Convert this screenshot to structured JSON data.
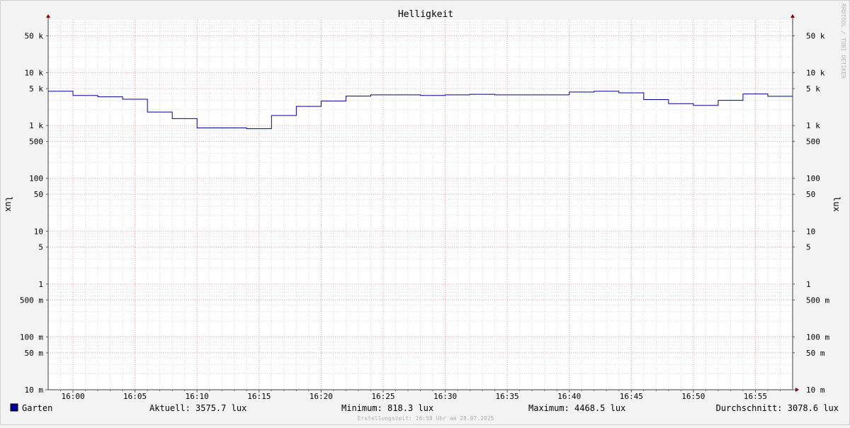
{
  "chart_data": {
    "type": "line",
    "title": "Helligkeit",
    "ylabel": "lux",
    "y_scale": "log",
    "ylim": [
      0.01,
      100000
    ],
    "y_ticks": [
      {
        "value": 50000,
        "label": "50 k",
        "major": true
      },
      {
        "value": 10000,
        "label": "10 k",
        "major": true
      },
      {
        "value": 5000,
        "label": "5 k",
        "major": true
      },
      {
        "value": 1000,
        "label": "1 k",
        "major": true
      },
      {
        "value": 500,
        "label": "500",
        "major": true
      },
      {
        "value": 100,
        "label": "100",
        "major": true
      },
      {
        "value": 50,
        "label": "50",
        "major": true
      },
      {
        "value": 10,
        "label": "10",
        "major": true
      },
      {
        "value": 5,
        "label": "5",
        "major": true
      },
      {
        "value": 1,
        "label": "1",
        "major": true
      },
      {
        "value": 0.5,
        "label": "500 m",
        "major": true
      },
      {
        "value": 0.1,
        "label": "100 m",
        "major": true
      },
      {
        "value": 0.05,
        "label": "50 m",
        "major": true
      },
      {
        "value": 0.01,
        "label": "10 m",
        "major": true
      }
    ],
    "x_range": [
      "15:58",
      "16:58"
    ],
    "x_ticks": [
      "16:00",
      "16:05",
      "16:10",
      "16:15",
      "16:20",
      "16:25",
      "16:30",
      "16:35",
      "16:40",
      "16:45",
      "16:50",
      "16:55"
    ],
    "grid": true,
    "series": [
      {
        "name": "Garten",
        "color": "#000099",
        "step": true,
        "points": [
          [
            "15:58",
            4450
          ],
          [
            "16:00",
            3700
          ],
          [
            "16:02",
            3500
          ],
          [
            "16:04",
            3150
          ],
          [
            "16:06",
            1800
          ],
          [
            "16:08",
            1350
          ],
          [
            "16:10",
            900
          ],
          [
            "16:14",
            870
          ],
          [
            "16:16",
            1550
          ],
          [
            "16:18",
            2300
          ],
          [
            "16:20",
            2900
          ],
          [
            "16:22",
            3600
          ],
          [
            "16:24",
            3800
          ],
          [
            "16:28",
            3700
          ],
          [
            "16:30",
            3800
          ],
          [
            "16:32",
            3900
          ],
          [
            "16:34",
            3800
          ],
          [
            "16:40",
            4300
          ],
          [
            "16:42",
            4450
          ],
          [
            "16:44",
            4150
          ],
          [
            "16:46",
            3100
          ],
          [
            "16:48",
            2600
          ],
          [
            "16:50",
            2400
          ],
          [
            "16:52",
            3000
          ],
          [
            "16:54",
            3950
          ],
          [
            "16:56",
            3575.7
          ],
          [
            "16:58",
            3575.7
          ]
        ]
      }
    ],
    "legend": {
      "name": "Garten",
      "color": "#000099",
      "stats": [
        {
          "label": "Aktuell: 3575.7 lux"
        },
        {
          "label": "Minimum: 818.3 lux"
        },
        {
          "label": "Maximum: 4468.5 lux"
        },
        {
          "label": "Durchschnitt: 3078.6 lux"
        }
      ]
    },
    "watermark": "RRDTOOL / TOBI OETIKER",
    "footer": "Erstellungszeit: 16:58 Uhr am 28.07.2025"
  }
}
